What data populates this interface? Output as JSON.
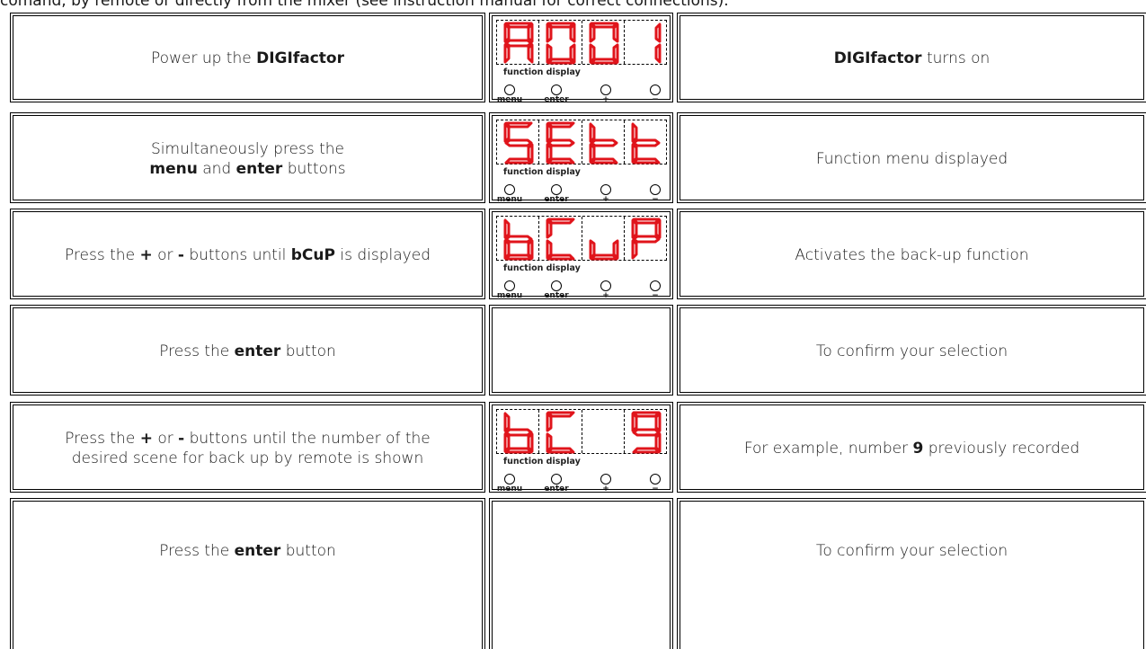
{
  "intro": "comand, by remote or directly from the mixer (see instruction manual for correct connections).",
  "panel": {
    "label": "function display",
    "buttons": [
      "menu",
      "enter",
      "+",
      "−"
    ],
    "segment_color": "#e0141b"
  },
  "rows": [
    {
      "action": [
        [
          "Power up the ",
          false
        ],
        [
          "DIGIfactor",
          true
        ]
      ],
      "display": [
        "A",
        "0",
        "0",
        "1"
      ],
      "result": [
        [
          "DIGIfactor",
          true
        ],
        [
          " turns on",
          false
        ]
      ]
    },
    {
      "action": [
        [
          "Simultaneously press the",
          false
        ],
        [
          "\n",
          false
        ],
        [
          "menu",
          true
        ],
        [
          " and ",
          false
        ],
        [
          "enter",
          true
        ],
        [
          " buttons",
          false
        ]
      ],
      "display": [
        "S",
        "E",
        "t",
        "t"
      ],
      "result": [
        [
          "Function menu displayed",
          false
        ]
      ]
    },
    {
      "action": [
        [
          "Press the ",
          false
        ],
        [
          "+",
          true
        ],
        [
          " or ",
          false
        ],
        [
          "-",
          true
        ],
        [
          " buttons until ",
          false
        ],
        [
          "bCuP",
          true
        ],
        [
          " is displayed",
          false
        ]
      ],
      "display": [
        "b",
        "C",
        "u",
        "P"
      ],
      "result": [
        [
          "Activates the back-up function",
          false
        ]
      ]
    },
    {
      "action": [
        [
          "Press the ",
          false
        ],
        [
          "enter",
          true
        ],
        [
          " button",
          false
        ]
      ],
      "display": null,
      "result": [
        [
          "To confirm your selection",
          false
        ]
      ]
    },
    {
      "action": [
        [
          "Press the ",
          false
        ],
        [
          "+",
          true
        ],
        [
          " or ",
          false
        ],
        [
          "-",
          true
        ],
        [
          " buttons until the number of the",
          false
        ],
        [
          "\n",
          false
        ],
        [
          "desired scene for back up by remote is shown",
          false
        ]
      ],
      "display": [
        "b",
        "C",
        " ",
        "9"
      ],
      "result": [
        [
          "For example, number ",
          false
        ],
        [
          "9",
          true
        ],
        [
          " previously recorded",
          false
        ]
      ]
    },
    {
      "action": [
        [
          "Press the ",
          false
        ],
        [
          "enter",
          true
        ],
        [
          " button",
          false
        ]
      ],
      "display": null,
      "result": [
        [
          "To confirm your selection",
          false
        ]
      ]
    }
  ]
}
